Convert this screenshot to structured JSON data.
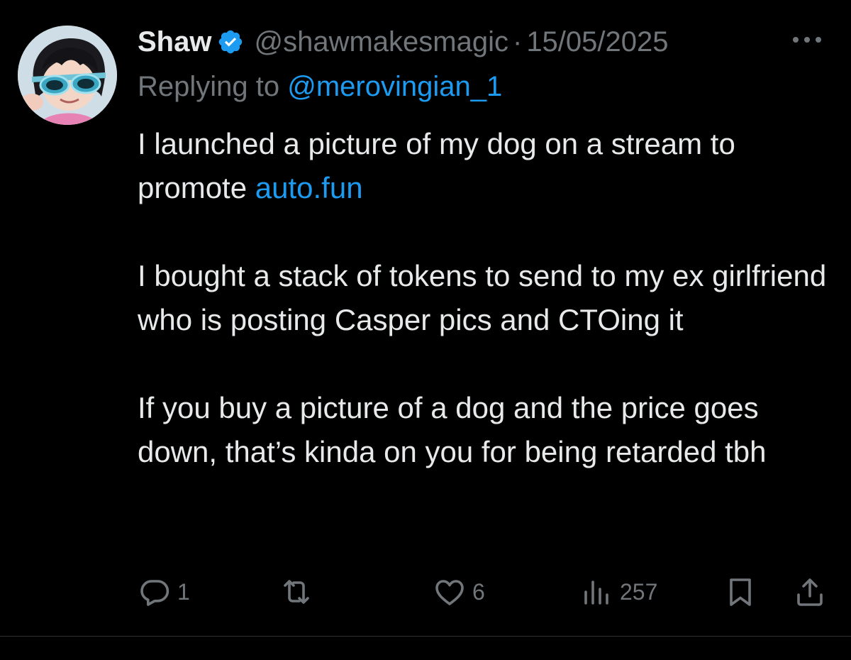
{
  "tweet": {
    "author": {
      "display_name": "Shaw",
      "verified": true,
      "handle": "@shawmakesmagic",
      "avatar_icon": "anime-avatar-with-sunglasses"
    },
    "separator": "·",
    "date": "15/05/2025",
    "replying_prefix": "Replying to",
    "replying_handle": "@merovingian_1",
    "body": {
      "p1_text": "I launched a picture of my dog on a stream to promote ",
      "p1_link": "auto.fun",
      "p2": "I bought a stack of tokens to send to my ex girlfriend who is posting Casper pics and CTOing it",
      "p3": "If you buy a picture of a dog and the price goes down, that’s kinda on you for being retarded tbh"
    },
    "actions": {
      "replies": "1",
      "reposts": "",
      "likes": "6",
      "views": "257"
    }
  },
  "colors": {
    "background": "#000000",
    "text_primary": "#e7e9ea",
    "text_secondary": "#71767b",
    "accent": "#1d9bf0",
    "divider": "#2f3336"
  }
}
